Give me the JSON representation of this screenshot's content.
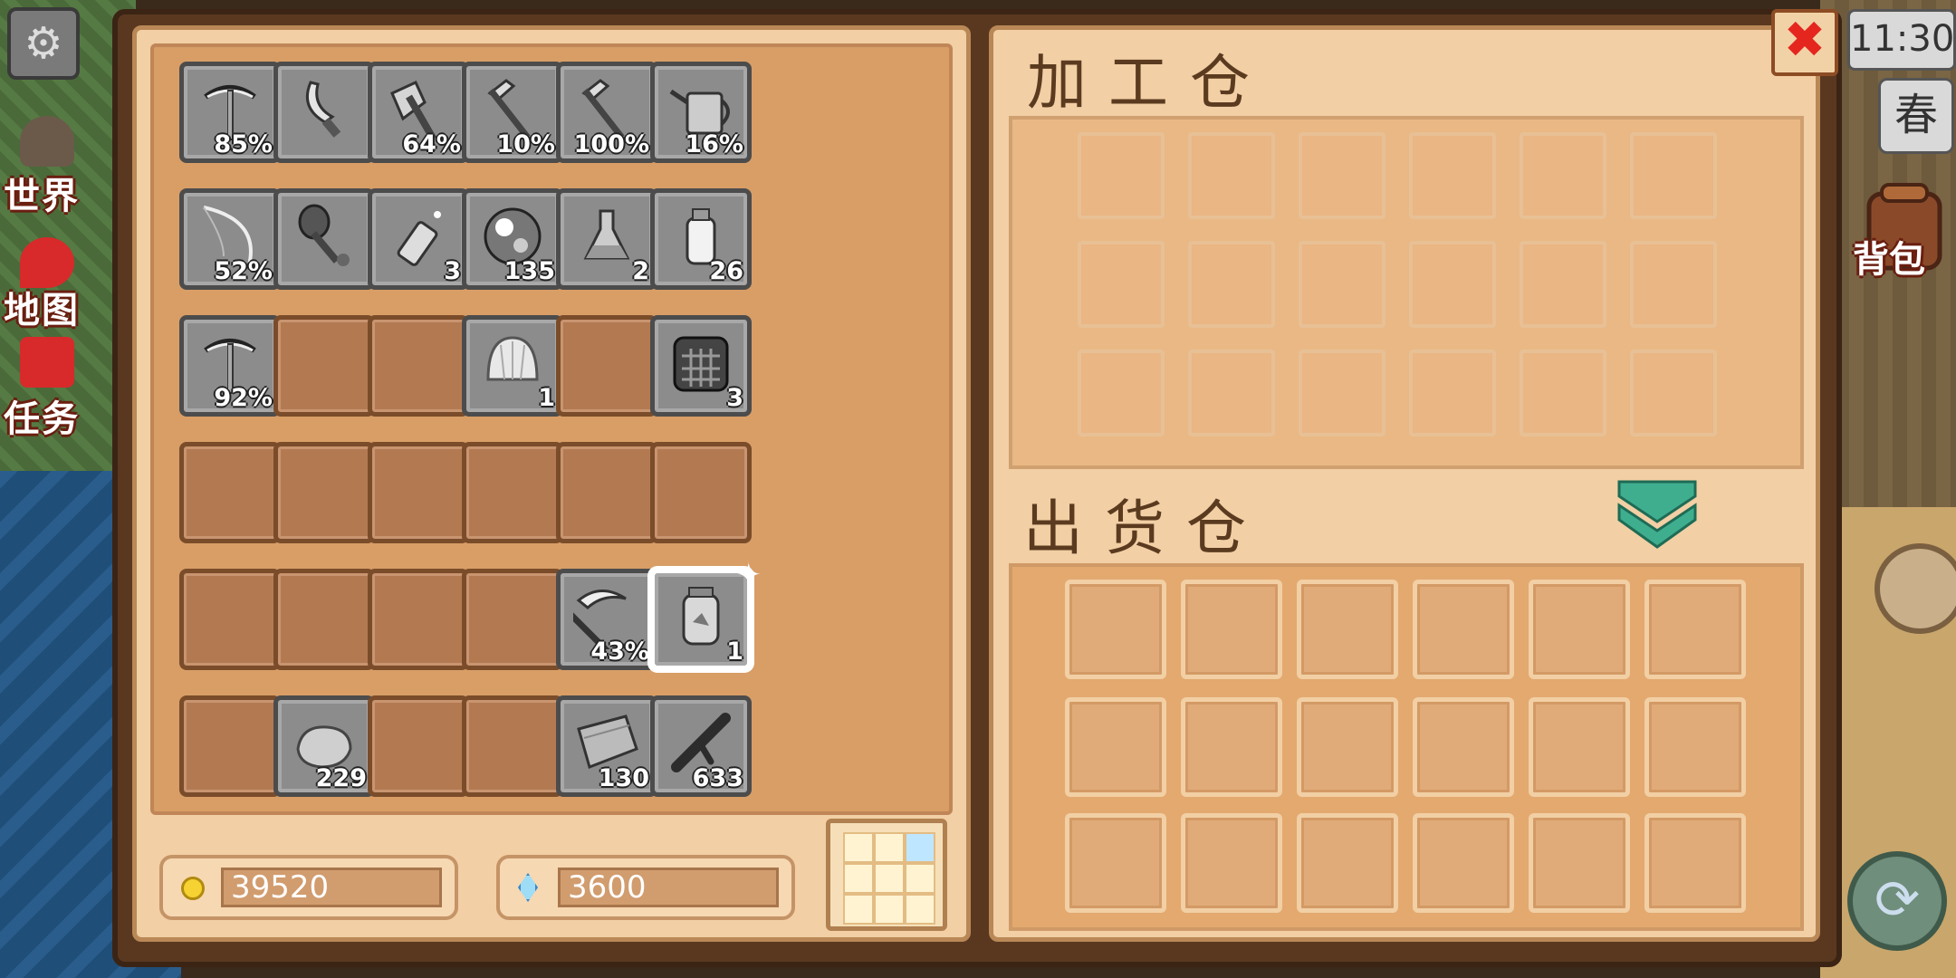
{
  "left_panel": {
    "slots": [
      {
        "item": "pickaxe",
        "icon": "pickaxe-icon",
        "count": "85%"
      },
      {
        "item": "sword",
        "icon": "sword-icon",
        "count": ""
      },
      {
        "item": "axe",
        "icon": "axe-icon",
        "count": "64%"
      },
      {
        "item": "hoe",
        "icon": "hoe-icon",
        "count": "10%"
      },
      {
        "item": "hoe",
        "icon": "hoe-icon",
        "count": "100%"
      },
      {
        "item": "watering-can",
        "icon": "watering-can-icon",
        "count": "16%"
      },
      {
        "item": "fishing-rod",
        "icon": "fishing-rod-icon",
        "count": "52%"
      },
      {
        "item": "shovel",
        "icon": "shovel-icon",
        "count": ""
      },
      {
        "item": "spray-bottle",
        "icon": "spray-bottle-icon",
        "count": "3"
      },
      {
        "item": "glass-orb",
        "icon": "orb-icon",
        "count": "135"
      },
      {
        "item": "flask",
        "icon": "flask-icon",
        "count": "2"
      },
      {
        "item": "milk-bottle",
        "icon": "bottle-icon",
        "count": "26"
      },
      {
        "item": "pickaxe",
        "icon": "pickaxe-icon",
        "count": "92%"
      },
      {
        "item": "",
        "icon": "",
        "count": ""
      },
      {
        "item": "",
        "icon": "",
        "count": ""
      },
      {
        "item": "shell",
        "icon": "shell-icon",
        "count": "1"
      },
      {
        "item": "",
        "icon": "",
        "count": ""
      },
      {
        "item": "cage",
        "icon": "cage-icon",
        "count": "3"
      },
      {
        "item": "",
        "icon": "",
        "count": ""
      },
      {
        "item": "",
        "icon": "",
        "count": ""
      },
      {
        "item": "",
        "icon": "",
        "count": ""
      },
      {
        "item": "",
        "icon": "",
        "count": ""
      },
      {
        "item": "",
        "icon": "",
        "count": ""
      },
      {
        "item": "",
        "icon": "",
        "count": ""
      },
      {
        "item": "",
        "icon": "",
        "count": ""
      },
      {
        "item": "",
        "icon": "",
        "count": ""
      },
      {
        "item": "",
        "icon": "",
        "count": ""
      },
      {
        "item": "",
        "icon": "",
        "count": ""
      },
      {
        "item": "scythe",
        "icon": "scythe-icon",
        "count": "43%"
      },
      {
        "item": "jar",
        "icon": "jar-icon",
        "count": "1"
      },
      {
        "item": "",
        "icon": "",
        "count": ""
      },
      {
        "item": "stone",
        "icon": "stone-icon",
        "count": "229"
      },
      {
        "item": "",
        "icon": "",
        "count": ""
      },
      {
        "item": "",
        "icon": "",
        "count": ""
      },
      {
        "item": "plank",
        "icon": "plank-icon",
        "count": "130"
      },
      {
        "item": "branch",
        "icon": "branch-icon",
        "count": "633"
      }
    ],
    "gold": "39520",
    "gems": "3600"
  },
  "right_panel": {
    "processing_title": "加工仓",
    "shipping_title": "出货仓"
  },
  "hud": {
    "time": "11:30",
    "season": "春",
    "world_label": "世界",
    "map_label": "地图",
    "quest_label": "任务",
    "bag_label": "背包"
  },
  "colors": {
    "panel": "#f2cfa4",
    "slot_empty": "#b37a52",
    "slot_filled": "#8c8c8c",
    "arrow": "#3fae8f",
    "close": "#e4261f"
  }
}
